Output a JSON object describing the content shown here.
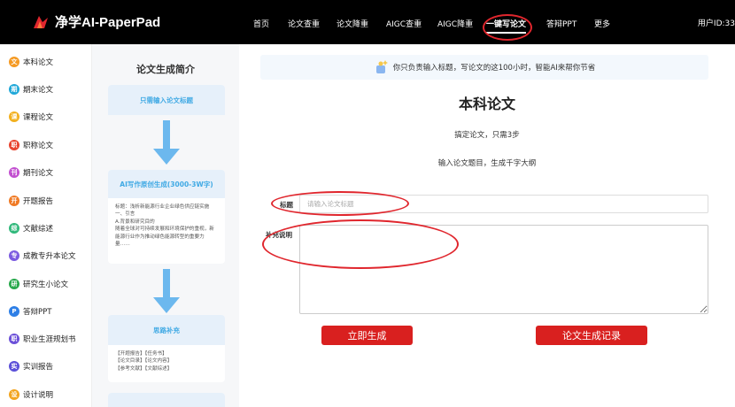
{
  "header": {
    "logo_text": "净学AI-PaperPad",
    "nav": [
      {
        "label": "首页",
        "active": false
      },
      {
        "label": "论文查重",
        "active": false
      },
      {
        "label": "论文降重",
        "active": false
      },
      {
        "label": "AIGC查重",
        "active": false
      },
      {
        "label": "AIGC降重",
        "active": false
      },
      {
        "label": "一键写论文",
        "active": true
      },
      {
        "label": "答辩PPT",
        "active": false
      },
      {
        "label": "更多",
        "active": false
      }
    ],
    "user_id": "用户ID:33"
  },
  "sidebar": {
    "items": [
      {
        "label": "本科论文",
        "color": "#f59a23",
        "icon": "document-icon"
      },
      {
        "label": "期末论文",
        "color": "#1ea7d8",
        "icon": "book-icon"
      },
      {
        "label": "课程论文",
        "color": "#f2b01e",
        "icon": "course-icon"
      },
      {
        "label": "职称论文",
        "color": "#e8432e",
        "icon": "title-icon"
      },
      {
        "label": "期刊论文",
        "color": "#c24fd0",
        "icon": "journal-icon"
      },
      {
        "label": "开题报告",
        "color": "#f07a24",
        "icon": "report-icon"
      },
      {
        "label": "文献综述",
        "color": "#2fb87a",
        "icon": "literature-icon"
      },
      {
        "label": "成教专升本论文",
        "color": "#7b5be0",
        "icon": "graduation-icon"
      },
      {
        "label": "研究生小论文",
        "color": "#27a84b",
        "icon": "chart-icon"
      },
      {
        "label": "答辩PPT",
        "color": "#2e7fe6",
        "icon": "ppt-icon"
      },
      {
        "label": "职业生涯规划书",
        "color": "#6a4fd8",
        "icon": "career-icon"
      },
      {
        "label": "实训报告",
        "color": "#5a4fd8",
        "icon": "training-icon"
      },
      {
        "label": "设计说明",
        "color": "#f2a41e",
        "icon": "design-icon"
      }
    ]
  },
  "intro": {
    "title": "论文生成简介",
    "step1": "只需输入论文标题",
    "step2": "AI写作原创生成(3000-3W字)",
    "step2_body": "标题：浅析新能源行业企业绿色供应链实施\n一、引言\nA.背景和研究目的\n随着全球对可持续发展和环境保护的重视，新能源行业作为推动绿色能源转型的重要力量……",
    "step3": "思路补充",
    "step3_body": "【开题报告】【任务书】\n【论文目录】【论文内容】\n【参考文献】【文献综述】"
  },
  "main": {
    "banner": "你只负责输入标题，写论文的这100小时，智能AI来帮你节省",
    "title": "本科论文",
    "subtitle1": "搞定论文，只需3步",
    "subtitle2": "输入论文题目，生成千字大纲",
    "title_label": "标题",
    "title_placeholder": "请输入论文标题",
    "supplement_label": "补充说明",
    "generate_button": "立即生成",
    "history_button": "论文生成记录"
  },
  "colors": {
    "accent": "#d9201f",
    "annotation": "#e0262d",
    "intro_head": "#3fa9e4"
  }
}
